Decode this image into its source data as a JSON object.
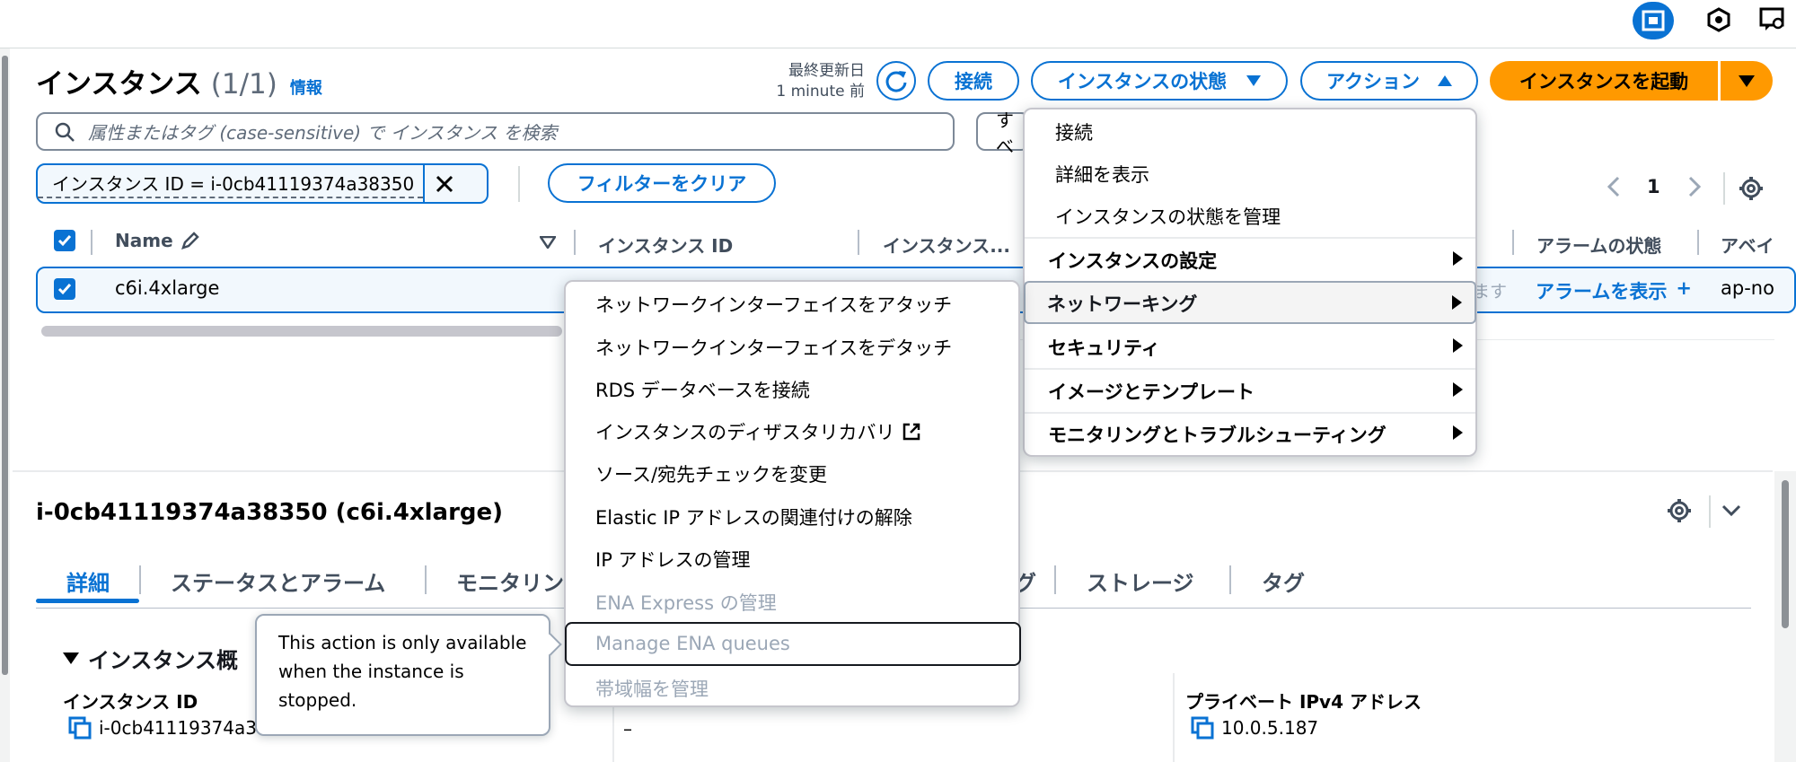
{
  "header": {
    "title": "インスタンス",
    "count": "(1/1)",
    "info": "情報",
    "last_updated_label": "最終更新日",
    "last_updated_value": "1 minute 前"
  },
  "toolbar": {
    "connect": "接続",
    "instance_state": "インスタンスの状態",
    "actions": "アクション",
    "launch": "インスタンスを起動"
  },
  "search": {
    "placeholder": "属性またはタグ (case-sensitive) で インスタンス を検索",
    "filter_dropdown_partial": "すべ"
  },
  "filter": {
    "chip": "インスタンス ID = i-0cb41119374a38350",
    "clear": "フィルターをクリア"
  },
  "pagination": {
    "page": "1"
  },
  "table": {
    "columns": [
      "Name",
      "インスタンス ID",
      "インスタンス...",
      "アラームの状態",
      "アベイ"
    ],
    "row": {
      "name": "c6i.4xlarge",
      "partial_text": "ます",
      "alarm_link": "アラームを表示",
      "alarm_plus": "+",
      "az": "ap-no"
    }
  },
  "details": {
    "title": "i-0cb41119374a38350 (c6i.4xlarge)",
    "tabs": [
      "詳細",
      "ステータスとアラーム",
      "モニタリン",
      "グ",
      "ストレージ",
      "タグ"
    ],
    "section": "インスタンス概",
    "instance_id_label": "インスタンス ID",
    "instance_id_value": "i-0cb41119374a3",
    "dash": "–",
    "private_ip_label": "プライベート IPv4 アドレス",
    "private_ip_value": "10.0.5.187"
  },
  "actions_menu": {
    "items_top": [
      "接続",
      "詳細を表示",
      "インスタンスの状態を管理"
    ],
    "items_sub": [
      "インスタンスの設定",
      "ネットワーキング",
      "セキュリティ",
      "イメージとテンプレート",
      "モニタリングとトラブルシューティング"
    ]
  },
  "networking_menu": {
    "items": [
      "ネットワークインターフェイスをアタッチ",
      "ネットワークインターフェイスをデタッチ",
      "RDS データベースを接続",
      "インスタンスのディザスタリカバリ",
      "ソース/宛先チェックを変更",
      "Elastic IP アドレスの関連付けの解除",
      "IP アドレスの管理"
    ],
    "disabled": [
      "ENA Express の管理",
      "Manage ENA queues",
      "帯域幅を管理"
    ]
  },
  "tooltip": {
    "text": "This action is only available when the instance is stopped."
  },
  "colors": {
    "accent": "#0972d3",
    "primary": "#ff9900"
  }
}
